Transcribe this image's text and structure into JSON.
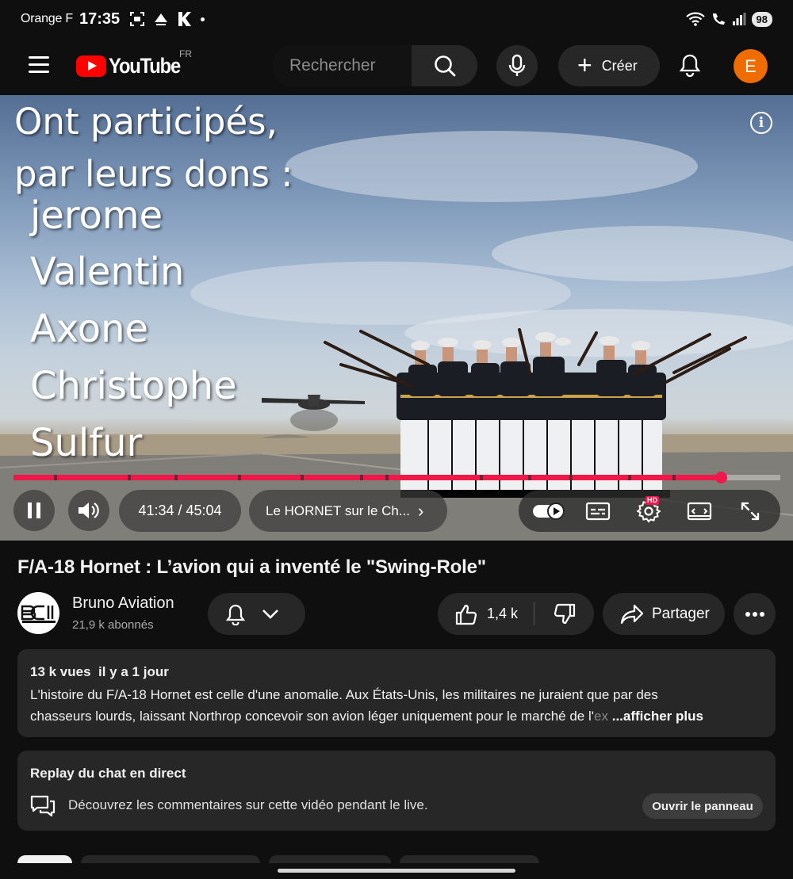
{
  "status_bar": {
    "carrier": "Orange F",
    "time": "17:35",
    "battery": "98"
  },
  "header": {
    "logo_text": "YouTube",
    "region": "FR",
    "search_placeholder": "Rechercher",
    "create_label": "Créer",
    "avatar_letter": "E",
    "avatar_color": "#ef6c00"
  },
  "player": {
    "overlay_heading": [
      "Ont participés,",
      "par leurs dons :"
    ],
    "donor_names": [
      "jerome",
      "Valentin",
      "Axone",
      "Christophe",
      "Sulfur"
    ],
    "time_display": "41:34 / 45:04",
    "progress_fraction": 0.922,
    "chapter_title": "Le HORNET sur le Ch...",
    "hd_badge": "HD",
    "accent_color": "#f01848"
  },
  "video": {
    "title": "F/A-18 Hornet : L’avion qui a inventé le \"Swing-Role\"",
    "channel_name": "Bruno Aviation",
    "channel_subs": "21,9 k abonnés",
    "likes": "1,4 k",
    "share_label": "Partager"
  },
  "description": {
    "views": "13 k vues",
    "date": "il y a 1 jour",
    "line1": "L'histoire du F/A-18 Hornet est celle d'une anomalie. Aux États-Unis, les militaires ne juraient que par des",
    "line2_start": "chasseurs lourds, laissant Northrop concevoir son avion léger uniquement pour le marché de l'",
    "line2_fade": "ex",
    "more_label": "...afficher plus"
  },
  "chat_replay": {
    "title": "Replay du chat en direct",
    "text": "Découvrez les commentaires sur cette vidéo pendant le live.",
    "button_label": "Ouvrir le panneau"
  },
  "icons": [
    "menu-icon",
    "youtube-play-icon",
    "search-icon",
    "mic-icon",
    "bell-icon",
    "info-icon",
    "pause-icon",
    "volume-icon",
    "chevron-right-icon",
    "autoplay-toggle-icon",
    "subtitles-icon",
    "settings-icon",
    "theater-mode-icon",
    "fullscreen-icon",
    "bell-outline-icon",
    "chevron-down-icon",
    "thumbs-up-icon",
    "thumbs-down-icon",
    "share-icon",
    "more-horizontal-icon",
    "chat-bubbles-icon"
  ]
}
